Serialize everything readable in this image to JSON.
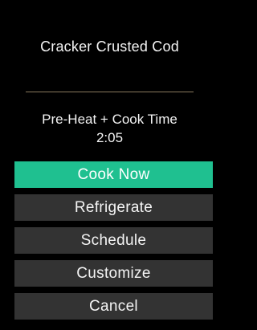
{
  "recipe": {
    "title": "Cracker Crusted Cod"
  },
  "cook_info": {
    "label": "Pre-Heat + Cook Time",
    "time": "2:05"
  },
  "actions": [
    {
      "label": "Cook Now",
      "primary": true
    },
    {
      "label": "Refrigerate",
      "primary": false
    },
    {
      "label": "Schedule",
      "primary": false
    },
    {
      "label": "Customize",
      "primary": false
    },
    {
      "label": "Cancel",
      "primary": false
    }
  ],
  "colors": {
    "background": "#000000",
    "primary_button": "#1fc090",
    "secondary_button": "#333333",
    "divider": "#8a7a5e",
    "text": "#f4f4f4"
  }
}
